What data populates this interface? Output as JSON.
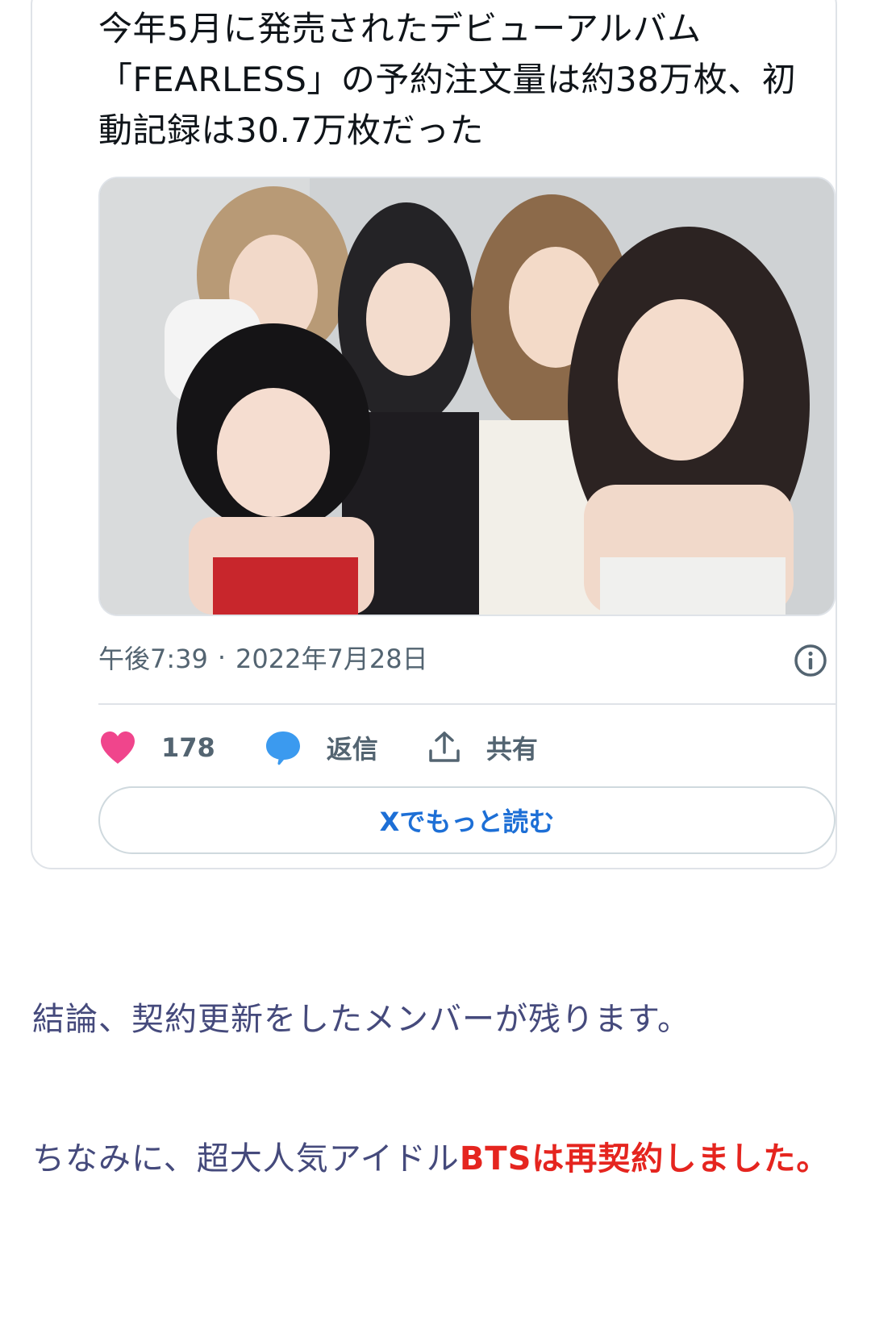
{
  "tweet": {
    "text": "今年5月に発売されたデビューアルバム「FEARLESS」の予約注文量は約38万枚、初動記録は30.7万枚だった",
    "time": "午後7:39",
    "separator": "·",
    "date": "2022年7月28日",
    "likes": "178",
    "reply_label": "返信",
    "share_label": "共有",
    "read_more_label": "Xでもっと読む",
    "icons": [
      "heart-icon",
      "reply-bubble-icon",
      "share-icon",
      "info-icon"
    ],
    "colors": {
      "heart": "#f0458c",
      "reply": "#3b9aef",
      "link": "#1d6fd6"
    }
  },
  "article": {
    "paragraph1": "結論、契約更新をしたメンバーが残ります。",
    "paragraph2_plain": "ちなみに、超大人気アイドル",
    "paragraph2_highlight": "BTSは再契約しました。",
    "highlight_color": "#e5251f"
  }
}
